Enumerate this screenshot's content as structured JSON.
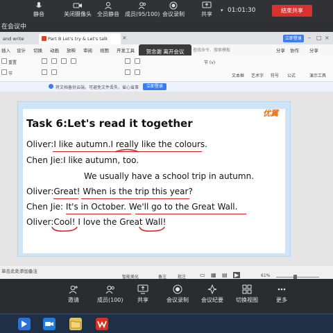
{
  "meeting_top": {
    "mute_label": "静音",
    "camera_label": "关闭摄像头",
    "mute_all_label": "全员静音",
    "members_label": "成员(95/100)",
    "record_label": "会议录制",
    "share_label": "共享",
    "elapsed": "01:01:30",
    "end_share_label": "结束共享"
  },
  "status_strip": {
    "text": "在会议中"
  },
  "wps": {
    "tabs": [
      {
        "label": "and write"
      },
      {
        "label": "Part B Let's try & Let's talk"
      }
    ],
    "login_label": "立即登录",
    "menu": [
      "插入",
      "设计",
      "切换",
      "动画",
      "放映",
      "审阅",
      "视图",
      "开发工具"
    ],
    "search_placeholder": "查找命令、搜索模板",
    "share_items": [
      "分享",
      "协作",
      "分享"
    ],
    "thanks_tooltip": "贺念谢 离开会议",
    "ribbon_labels": [
      "重置",
      "节",
      "节 (v)",
      "文本框",
      "艺术字",
      "符号",
      "公式",
      "演示工具"
    ],
    "notice_text": "将文档备份云端，可避免文件丢失，省心省事",
    "notice_button": "立即登录"
  },
  "slide": {
    "logo": "优翼",
    "title": "Task 6:Let's read it together",
    "lines": [
      "Oliver:I like autumn.I really like the colours.",
      "Chen Jie:I like autumn, too.",
      "We usually have a school trip in autumn.",
      "Oliver:Great! When is the trip this year?",
      "Chen Jie: It's in October. We'll go to the Great Wall.",
      "Oliver:Cool! I love the Great Wall!"
    ]
  },
  "wps_status": {
    "notes_label": "单击此处添加备注",
    "smart_label": "智能美化",
    "note_label": "备注",
    "comment_label": "批注",
    "zoom": "61%"
  },
  "meeting_bottom": {
    "items": [
      "邀请",
      "成员(100)",
      "共享",
      "会议录制",
      "会议纪要",
      "切换视图",
      "更多"
    ]
  },
  "colors": {
    "accent": "#3b7cf0",
    "end_red": "#d9322d",
    "slide_frame": "#cfe4f6",
    "ink_red": "#d32222"
  }
}
